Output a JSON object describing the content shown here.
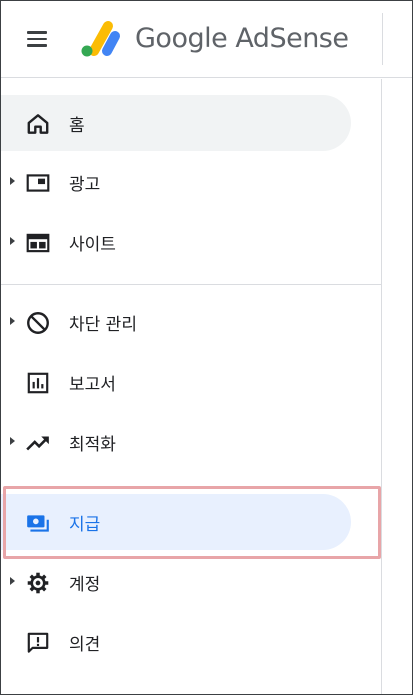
{
  "header": {
    "menu_icon": "hamburger-menu-icon",
    "logo_icon": "adsense-logo-icon",
    "brand_google": "Google",
    "brand_product": "AdSense"
  },
  "sidebar": {
    "items": [
      {
        "id": "home",
        "label": "홈",
        "icon": "home-icon",
        "expandable": false,
        "state": "selected-gray"
      },
      {
        "id": "ads",
        "label": "광고",
        "icon": "ad-unit-icon",
        "expandable": true
      },
      {
        "id": "sites",
        "label": "사이트",
        "icon": "web-layout-icon",
        "expandable": true
      },
      {
        "id": "blocking",
        "label": "차단 관리",
        "icon": "block-icon",
        "expandable": true
      },
      {
        "id": "reports",
        "label": "보고서",
        "icon": "bar-chart-icon",
        "expandable": false
      },
      {
        "id": "optimization",
        "label": "최적화",
        "icon": "trending-up-icon",
        "expandable": true
      },
      {
        "id": "payments",
        "label": "지급",
        "icon": "payments-icon",
        "expandable": false,
        "state": "active"
      },
      {
        "id": "account",
        "label": "계정",
        "icon": "settings-gear-icon",
        "expandable": true
      },
      {
        "id": "feedback",
        "label": "의견",
        "icon": "feedback-icon",
        "expandable": false
      }
    ]
  },
  "colors": {
    "active_bg": "#e8f0fe",
    "active_fg": "#1a73e8",
    "home_bg": "#f1f3f4",
    "highlight_border": "#e8a5a8",
    "logo_yellow": "#fbbc04",
    "logo_blue": "#4285f4",
    "logo_green": "#34a853"
  }
}
